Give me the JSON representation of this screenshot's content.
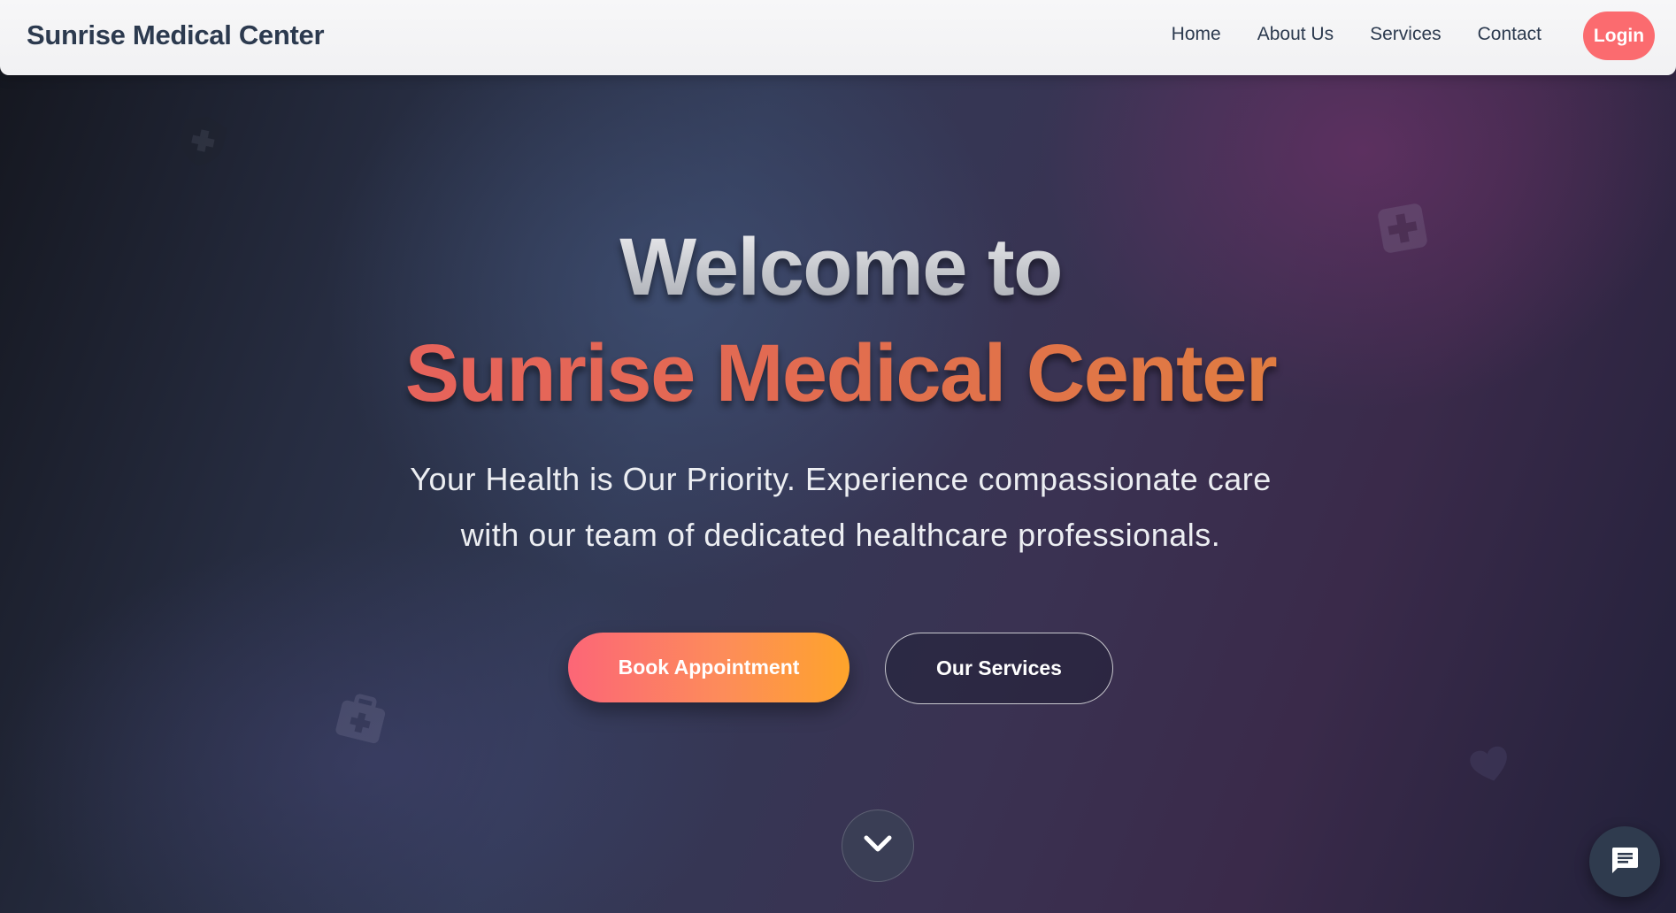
{
  "navbar": {
    "brand": "Sunrise Medical Center",
    "links": [
      {
        "label": "Home"
      },
      {
        "label": "About Us"
      },
      {
        "label": "Services"
      },
      {
        "label": "Contact"
      }
    ],
    "login_label": "Login"
  },
  "hero": {
    "title_line1": "Welcome to",
    "title_line2": "Sunrise Medical Center",
    "subtitle": "Your Health is Our Priority. Experience compassionate care with our team of dedicated healthcare professionals.",
    "primary_button": "Book Appointment",
    "secondary_button": "Our Services"
  },
  "decorations": {
    "icons": [
      "shield-medical-icon",
      "medical-cross-square-icon",
      "medical-kit-icon",
      "heart-icon"
    ]
  },
  "controls": {
    "scroll_icon": "chevron-down-icon",
    "chat_icon": "chat-message-icon"
  },
  "colors": {
    "accent": "#fb6b6f",
    "gradient_start": "#fc6677",
    "gradient_end": "#fea42b",
    "brand_text": "#2c3a4f"
  }
}
